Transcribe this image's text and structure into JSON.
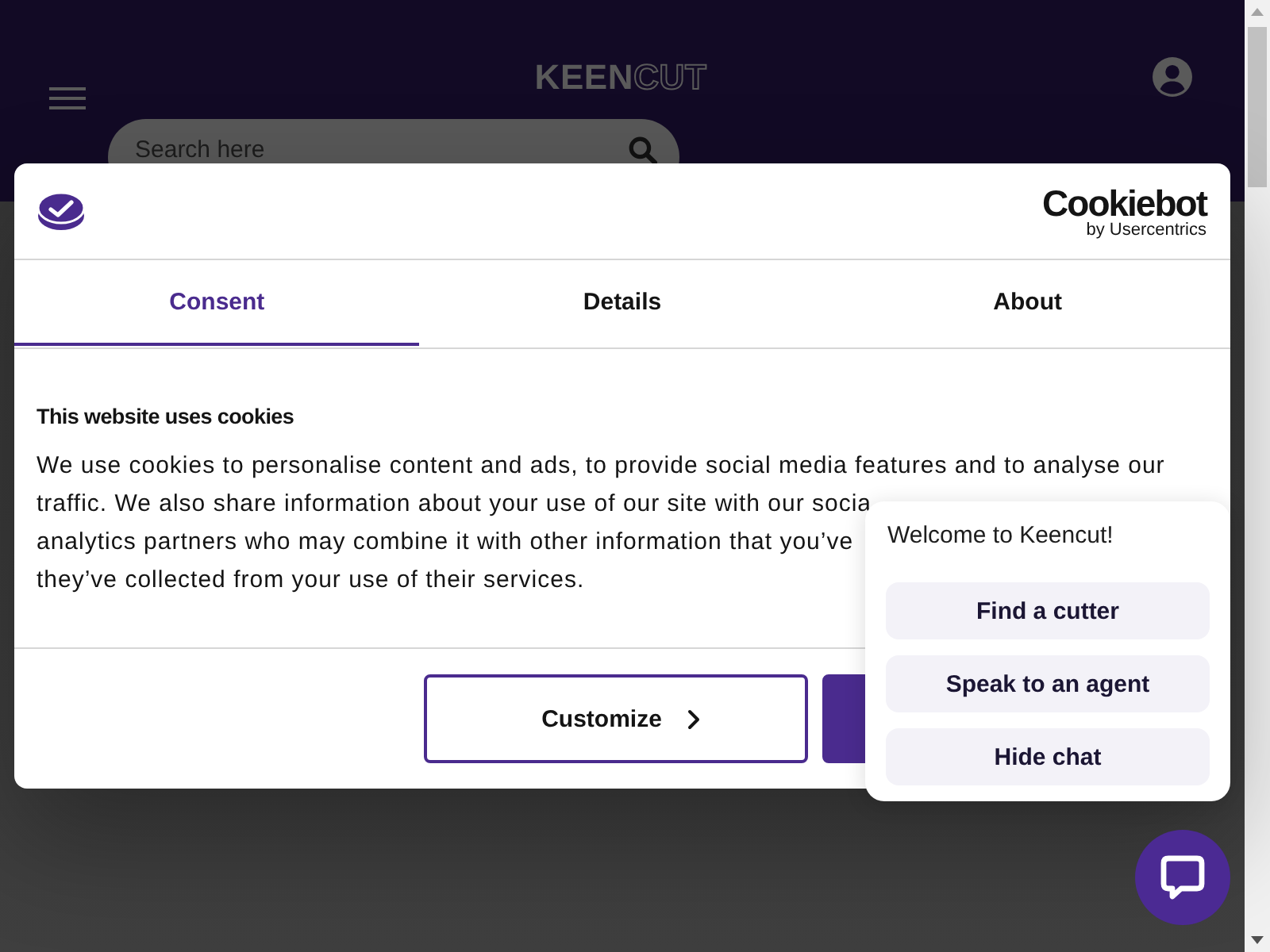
{
  "header": {
    "logo": {
      "filled": "KEEN",
      "outlined": "CUT"
    },
    "search": {
      "placeholder": "Search here"
    }
  },
  "cookie_dialog": {
    "brand": {
      "name": "Cookiebot",
      "byline": "by Usercentrics"
    },
    "tabs": [
      {
        "label": "Consent",
        "selected": true
      },
      {
        "label": "Details",
        "selected": false
      },
      {
        "label": "About",
        "selected": false
      }
    ],
    "title": "This website uses cookies",
    "body_lines": [
      "We use cookies to personalise content and ads, to provide social media features and to analyse our",
      "traffic. We also share information about your use of our site with our socia",
      "analytics partners who may combine it with other information that you’ve",
      "they’ve collected from your use of their services."
    ],
    "buttons": [
      {
        "kind": "outline",
        "label": "Customize"
      },
      {
        "kind": "filled"
      }
    ]
  },
  "chat": {
    "greeting": "Welcome to Keencut!",
    "options": [
      "Find a cutter",
      "Speak to an agent",
      "Hide chat"
    ]
  }
}
